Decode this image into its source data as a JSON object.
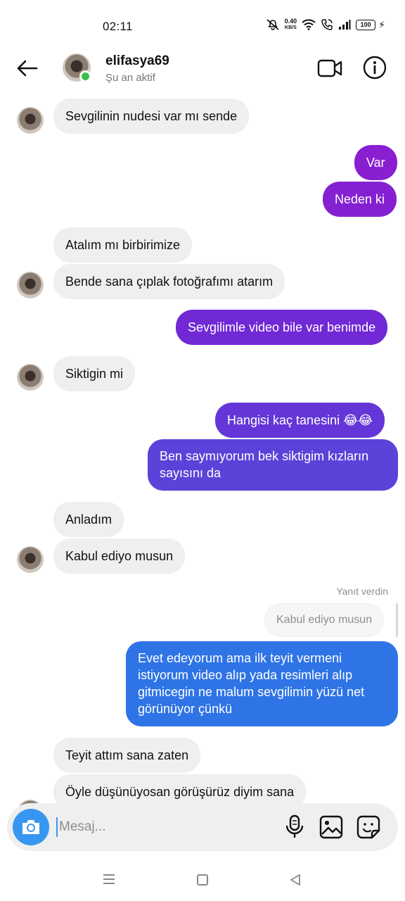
{
  "status_bar": {
    "time": "02:11",
    "speed_value": "0.40",
    "speed_unit": "KB/S",
    "battery": "100"
  },
  "header": {
    "username": "elifasya69",
    "status": "Şu an aktif"
  },
  "messages": [
    {
      "side": "in",
      "text": "Sevgilinin nudesi var mı sende"
    },
    {
      "side": "out",
      "text": "Var"
    },
    {
      "side": "out",
      "text": "Neden ki"
    },
    {
      "side": "in",
      "text": "Atalım mı birbirimize"
    },
    {
      "side": "in",
      "text": "Bende sana çıplak fotoğrafımı atarım"
    },
    {
      "side": "out",
      "text": "Sevgilimle video bile var benimde"
    },
    {
      "side": "in",
      "text": "Siktigin mi"
    },
    {
      "side": "out",
      "text": "Hangisi kaç tanesini 😂😂"
    },
    {
      "side": "out",
      "text": "Ben saymıyorum bek siktigim kızların sayısını da"
    },
    {
      "side": "in",
      "text": "Anladım"
    },
    {
      "side": "in",
      "text": "Kabul ediyo musun"
    },
    {
      "side": "out",
      "text": "Evet edeyorum ama ilk teyit vermeni istiyorum video alıp yada resimleri alıp gitmicegin ne malum sevgilimin yüzü net görünüyor çünkü"
    },
    {
      "side": "in",
      "text": "Teyit attım sana zaten"
    },
    {
      "side": "in",
      "text": "Öyle düşünüyosan görüşürüz diyim sana"
    }
  ],
  "reply": {
    "label": "Yanıt verdin",
    "quoted": "Kabul ediyo musun"
  },
  "composer": {
    "placeholder": "Mesaj..."
  },
  "colors": {
    "bubble_in": "#efefef",
    "gradient_top": "#8a1fd1",
    "gradient_mid": "#5b3fd8",
    "gradient_bottom": "#2f7ce8",
    "accent": "#3797f0",
    "online": "#37c24a"
  },
  "icons": [
    "back-arrow-icon",
    "video-call-icon",
    "info-icon",
    "camera-icon",
    "microphone-icon",
    "gallery-icon",
    "sticker-icon",
    "nav-menu-icon",
    "nav-home-icon",
    "nav-back-icon",
    "mute-icon",
    "wifi-icon",
    "call-icon",
    "signal-icon",
    "battery-icon",
    "charging-icon"
  ]
}
